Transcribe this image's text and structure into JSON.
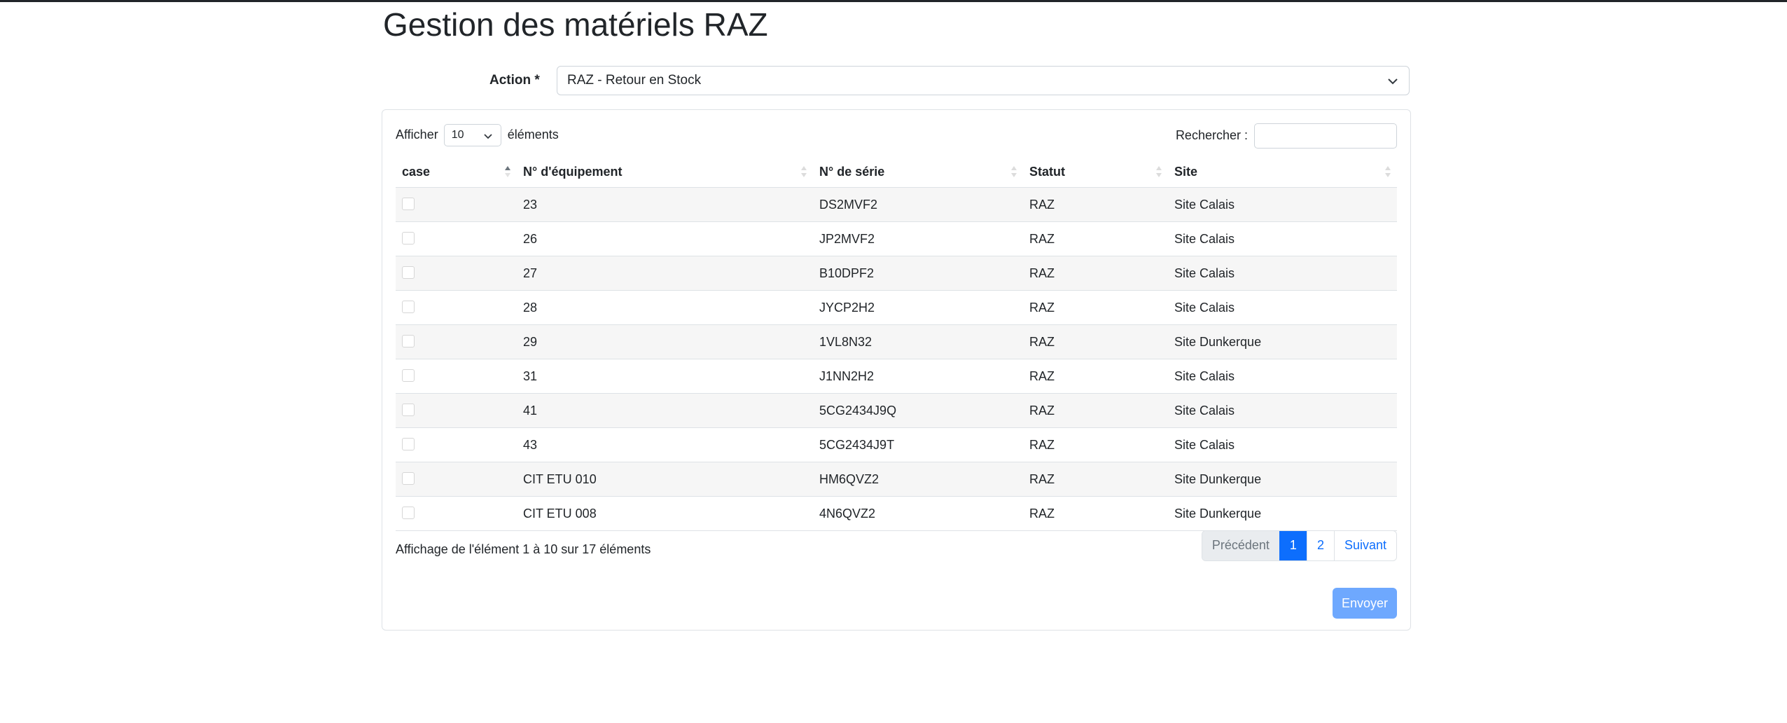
{
  "page": {
    "title": "Gestion des matériels RAZ"
  },
  "action": {
    "label": "Action *",
    "selected": "RAZ - Retour en Stock"
  },
  "table_controls": {
    "show_prefix": "Afficher",
    "page_length": "10",
    "show_suffix": "éléments",
    "search_label": "Rechercher :",
    "search_value": ""
  },
  "table": {
    "columns": [
      "case",
      "N° d'équipement",
      "N° de série",
      "Statut",
      "Site"
    ],
    "rows": [
      {
        "equipment": "23",
        "serial": "DS2MVF2",
        "status": "RAZ",
        "site": "Site Calais"
      },
      {
        "equipment": "26",
        "serial": "JP2MVF2",
        "status": "RAZ",
        "site": "Site Calais"
      },
      {
        "equipment": "27",
        "serial": "B10DPF2",
        "status": "RAZ",
        "site": "Site Calais"
      },
      {
        "equipment": "28",
        "serial": "JYCP2H2",
        "status": "RAZ",
        "site": "Site Calais"
      },
      {
        "equipment": "29",
        "serial": "1VL8N32",
        "status": "RAZ",
        "site": "Site Dunkerque"
      },
      {
        "equipment": "31",
        "serial": "J1NN2H2",
        "status": "RAZ",
        "site": "Site Calais"
      },
      {
        "equipment": "41",
        "serial": "5CG2434J9Q",
        "status": "RAZ",
        "site": "Site Calais"
      },
      {
        "equipment": "43",
        "serial": "5CG2434J9T",
        "status": "RAZ",
        "site": "Site Calais"
      },
      {
        "equipment": "CIT ETU 010",
        "serial": "HM6QVZ2",
        "status": "RAZ",
        "site": "Site Dunkerque"
      },
      {
        "equipment": "CIT ETU 008",
        "serial": "4N6QVZ2",
        "status": "RAZ",
        "site": "Site Dunkerque"
      }
    ]
  },
  "footer": {
    "info": "Affichage de l'élément 1 à 10 sur 17 éléments",
    "pagination": {
      "previous": "Précédent",
      "pages": [
        "1",
        "2"
      ],
      "next": "Suivant",
      "current": "1"
    },
    "submit_label": "Envoyer"
  },
  "colors": {
    "primary": "#0d6efd",
    "submit_disabled": "#6ea8fe",
    "stripe": "#f6f6f6"
  }
}
